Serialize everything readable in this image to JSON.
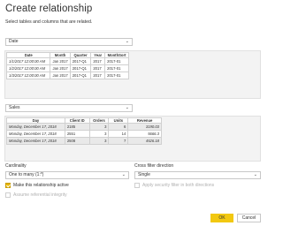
{
  "dialog": {
    "title": "Create relationship",
    "subtitle": "Select tables and columns that are related."
  },
  "table1": {
    "selected": "Date",
    "columns": [
      "Date",
      "Month",
      "Quarter",
      "Year",
      "MonthSort"
    ],
    "rows": [
      [
        "1/1/2017 12:00:00 AM",
        "Jan 2017",
        "2017-Q1",
        "2017",
        "2017-01"
      ],
      [
        "1/2/2017 12:00:00 AM",
        "Jan 2017",
        "2017-Q1",
        "2017",
        "2017-01"
      ],
      [
        "1/3/2017 12:00:00 AM",
        "Jan 2017",
        "2017-Q1",
        "2017",
        "2017-01"
      ]
    ]
  },
  "table2": {
    "selected": "Sales",
    "columns": [
      "Day",
      "Client ID",
      "Orders",
      "Units",
      "Revenue"
    ],
    "rows": [
      [
        "Monday, December 17, 2018",
        "2185",
        "3",
        "6",
        "3190.03"
      ],
      [
        "Monday, December 17, 2018",
        "2551",
        "3",
        "14",
        "5666.3"
      ],
      [
        "Monday, December 17, 2018",
        "2508",
        "3",
        "7",
        "4526.18"
      ]
    ]
  },
  "cardinality": {
    "label": "Cardinality",
    "value": "One to many (1:*)"
  },
  "cross_filter": {
    "label": "Cross filter direction",
    "value": "Single"
  },
  "options": {
    "active": "Make this relationship active",
    "security": "Apply security filter in both directions",
    "integrity": "Assume referential integrity"
  },
  "buttons": {
    "ok": "OK",
    "cancel": "Cancel"
  },
  "colors": {
    "accent": "#f2c811",
    "check": "#e8b600"
  },
  "icons": {
    "dropdown": "chevron-down-icon",
    "check": "checkmark-icon"
  }
}
